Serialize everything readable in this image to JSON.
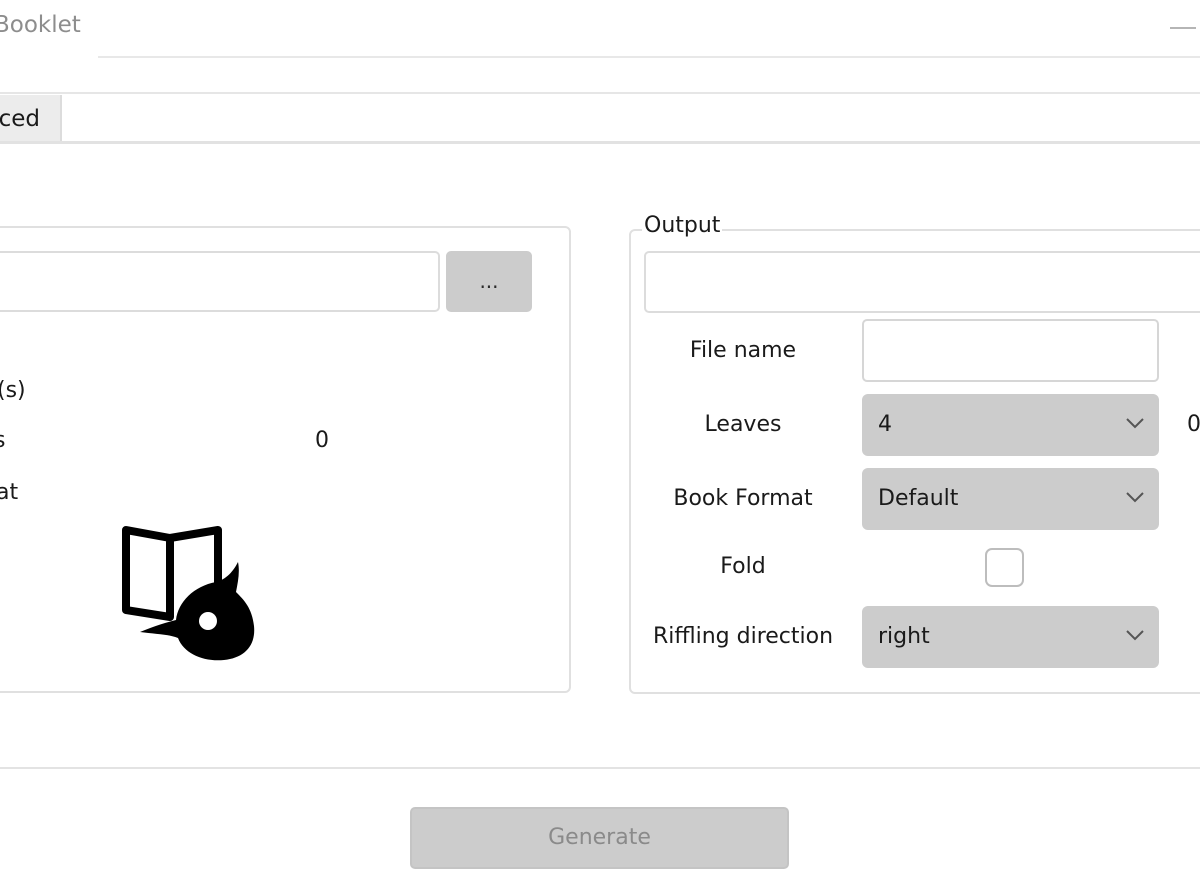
{
  "window": {
    "title": "Booklet"
  },
  "tabs": {
    "advanced_label": "ced"
  },
  "input": {
    "browse_label": "...",
    "labels": {
      "s": "(s)",
      "es": "s",
      "at": "at"
    },
    "pages_value": "0"
  },
  "output": {
    "legend": "Output",
    "file_name_label": "File name",
    "leaves_label": "Leaves",
    "leaves_value": "4",
    "leaves_extra": "0",
    "book_format_label": "Book Format",
    "book_format_value": "Default",
    "fold_label": "Fold",
    "fold_checked": false,
    "riffling_label": "Riffling direction",
    "riffling_value": "right"
  },
  "actions": {
    "generate_label": "Generate"
  },
  "icons": {
    "minimize": "minimize-icon",
    "logo": "booklet-logo-icon",
    "chevron": "chevron-down-icon"
  },
  "colors": {
    "control_fill": "#cccccc",
    "border": "#e0e0e0",
    "disabled_text": "#8a8a8a"
  }
}
